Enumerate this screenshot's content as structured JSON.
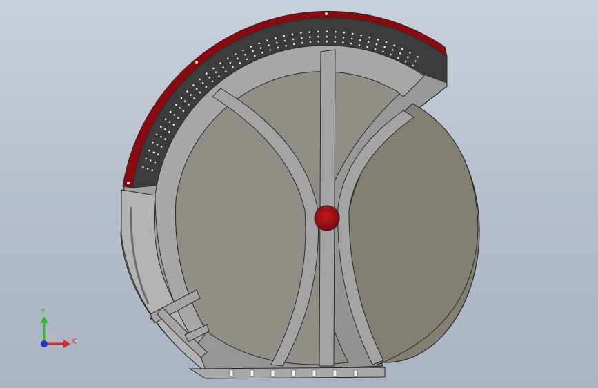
{
  "viewport": {
    "background_top": "#c9d0da",
    "background_bottom": "#a9b3c2"
  },
  "colors": {
    "panel_gray": "#9c9c9c",
    "panel_light": "#bdbdbd",
    "disk_face": "#908e87",
    "back_disk": "#837f73",
    "perforated_band": "#3c3c3c",
    "rim_red": "#8a0a10",
    "hub_red": "#9a0e12",
    "edge": "#2a2a2a"
  },
  "triad": {
    "x_label": "X",
    "y_label": "Y",
    "x_color": "#e0262c",
    "y_color": "#2bbf2b",
    "z_color": "#2432d6"
  },
  "icons": {
    "triad": "coordinate-triad-icon"
  }
}
